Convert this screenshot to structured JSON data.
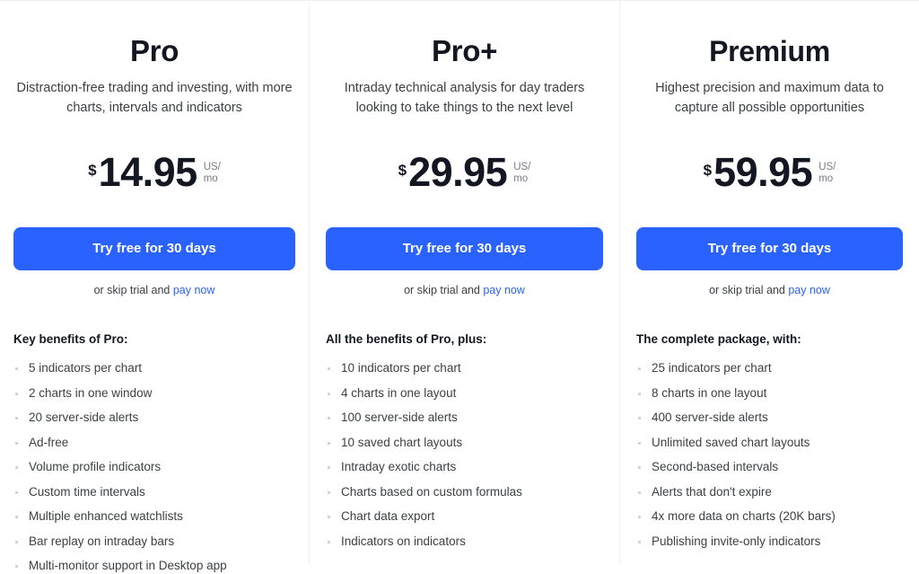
{
  "theme": {
    "accent_blue": "#2962FF",
    "text_primary": "#131722",
    "text_secondary": "#3C4043",
    "text_muted": "#787B86",
    "divider": "#EEF0F3",
    "bullet": "#D1D4DC",
    "background": "#FFFFFF"
  },
  "plans": [
    {
      "id": "pro",
      "title": "Pro",
      "description": "Distraction-free trading and investing, with more charts, intervals and indicators",
      "currency_symbol": "$",
      "price": "14.95",
      "period": "US/\nmo",
      "cta_label": "Try free for 30 days",
      "skip_trial_prefix": "or skip trial and ",
      "pay_now_label": "pay now",
      "benefits_heading": "Key benefits of Pro:",
      "benefits": [
        "5 indicators per chart",
        "2 charts in one window",
        "20 server-side alerts",
        "Ad-free",
        "Volume profile indicators",
        "Custom time intervals",
        "Multiple enhanced watchlists",
        "Bar replay on intraday bars",
        "Multi-monitor support in Desktop app"
      ]
    },
    {
      "id": "proplus",
      "title": "Pro+",
      "description": "Intraday technical analysis for day traders looking to take things to the next level",
      "currency_symbol": "$",
      "price": "29.95",
      "period": "US/\nmo",
      "cta_label": "Try free for 30 days",
      "skip_trial_prefix": "or skip trial and ",
      "pay_now_label": "pay now",
      "benefits_heading": "All the benefits of Pro, plus:",
      "benefits": [
        "10 indicators per chart",
        "4 charts in one layout",
        "100 server-side alerts",
        "10 saved chart layouts",
        "Intraday exotic charts",
        "Charts based on custom formulas",
        "Chart data export",
        "Indicators on indicators"
      ]
    },
    {
      "id": "premium",
      "title": "Premium",
      "description": "Highest precision and maximum data to capture all possible opportunities",
      "currency_symbol": "$",
      "price": "59.95",
      "period": "US/\nmo",
      "cta_label": "Try free for 30 days",
      "skip_trial_prefix": "or skip trial and ",
      "pay_now_label": "pay now",
      "benefits_heading": "The complete package, with:",
      "benefits": [
        "25 indicators per chart",
        "8 charts in one layout",
        "400 server-side alerts",
        "Unlimited saved chart layouts",
        "Second-based intervals",
        "Alerts that don't expire",
        "4x more data on charts (20K bars)",
        "Publishing invite-only indicators"
      ]
    }
  ]
}
